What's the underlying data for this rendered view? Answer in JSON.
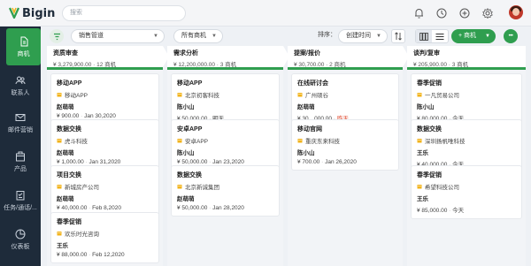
{
  "app": {
    "name": "Bigin"
  },
  "header": {
    "search_placeholder": "搜索"
  },
  "sidebar": {
    "items": [
      {
        "label": "商机",
        "icon": "deal-icon"
      },
      {
        "label": "联系人",
        "icon": "contacts-icon"
      },
      {
        "label": "邮件营销",
        "icon": "mail-icon"
      },
      {
        "label": "产品",
        "icon": "product-icon"
      },
      {
        "label": "任务/通话/...",
        "icon": "tasks-icon"
      },
      {
        "label": "仪表板",
        "icon": "dashboard-icon"
      }
    ]
  },
  "toolbar": {
    "pipeline": "销售管道",
    "view": "所有商机",
    "sort_label": "排序：",
    "sort_value": "创建时间",
    "add_label": "+ 商机",
    "more_label": "•••"
  },
  "columns": [
    {
      "name": "资质审查",
      "summary": "¥ 3,279,900.00 · 12 商机",
      "color": "#2f9e4f",
      "cards": [
        {
          "title": "移动APP",
          "company": "移动APP",
          "contact": "赵萌萌",
          "amount": "¥ 900.00",
          "sep": " · ",
          "date": "Jan 30,2020",
          "late": false
        },
        {
          "title": "数据交换",
          "company": "虎斗科技",
          "contact": "赵萌萌",
          "amount": "¥ 1,000.00",
          "sep": " · ",
          "date": "Jan 31,2020",
          "late": false
        },
        {
          "title": "项目交换",
          "company": "新城房产公司",
          "contact": "赵萌萌",
          "amount": "¥ 40,000.00",
          "sep": " · ",
          "date": "Feb 8,2020",
          "late": false
        },
        {
          "title": "春季促销",
          "company": "欢乐时光咨询",
          "contact": "王乐",
          "amount": "¥ 88,000.00",
          "sep": " · ",
          "date": "Feb 12,2020",
          "late": false
        }
      ]
    },
    {
      "name": "需求分析",
      "summary": "¥ 12,200,000.00 · 3 商机",
      "color": "#2f9e4f",
      "cards": [
        {
          "title": "移动APP",
          "company": "北京初客科技",
          "contact": "陈小山",
          "amount": "¥ 50,000.00",
          "sep": " · ",
          "date": "明天",
          "late": false
        },
        {
          "title": "安卓APP",
          "company": "安卓APP",
          "contact": "陈小山",
          "amount": "¥ 50,000.00",
          "sep": " · ",
          "date": "Jan 23,2020",
          "late": false
        },
        {
          "title": "数据交换",
          "company": "北京新诚集团",
          "contact": "赵萌萌",
          "amount": "¥ 50,000.00",
          "sep": " · ",
          "date": "Jan 28,2020",
          "late": false
        }
      ]
    },
    {
      "name": "提案/报价",
      "summary": "¥ 30,700.00 · 2 商机",
      "color": "#2f9e4f",
      "cards": [
        {
          "title": "在线研讨会",
          "company": "广州硕谷",
          "contact": "赵萌萌",
          "amount": "¥ 30，000.00",
          "sep": " · ",
          "date": "昨天",
          "late": true
        },
        {
          "title": "移动官网",
          "company": "重庆东来科技",
          "contact": "陈小山",
          "amount": "¥ 700.00",
          "sep": " · ",
          "date": "Jan 26,2020",
          "late": false
        }
      ]
    },
    {
      "name": "谈判/复审",
      "summary": "¥ 205,900.00 · 3 商机",
      "color": "#2f9e4f",
      "cards": [
        {
          "title": "春季促销",
          "company": "一凡贸易公司",
          "contact": "陈小山",
          "amount": "¥ 80,000.00",
          "sep": " · ",
          "date": "今天",
          "late": false
        },
        {
          "title": "数据交换",
          "company": "深圳扬帆唯科技",
          "contact": "王乐",
          "amount": "¥ 40,000.00",
          "sep": " · ",
          "date": "今天",
          "late": false
        },
        {
          "title": "春季促销",
          "company": "希望科技公司",
          "contact": "王乐",
          "amount": "¥ 85,000.00",
          "sep": " · ",
          "date": "今天",
          "late": false
        }
      ]
    }
  ]
}
